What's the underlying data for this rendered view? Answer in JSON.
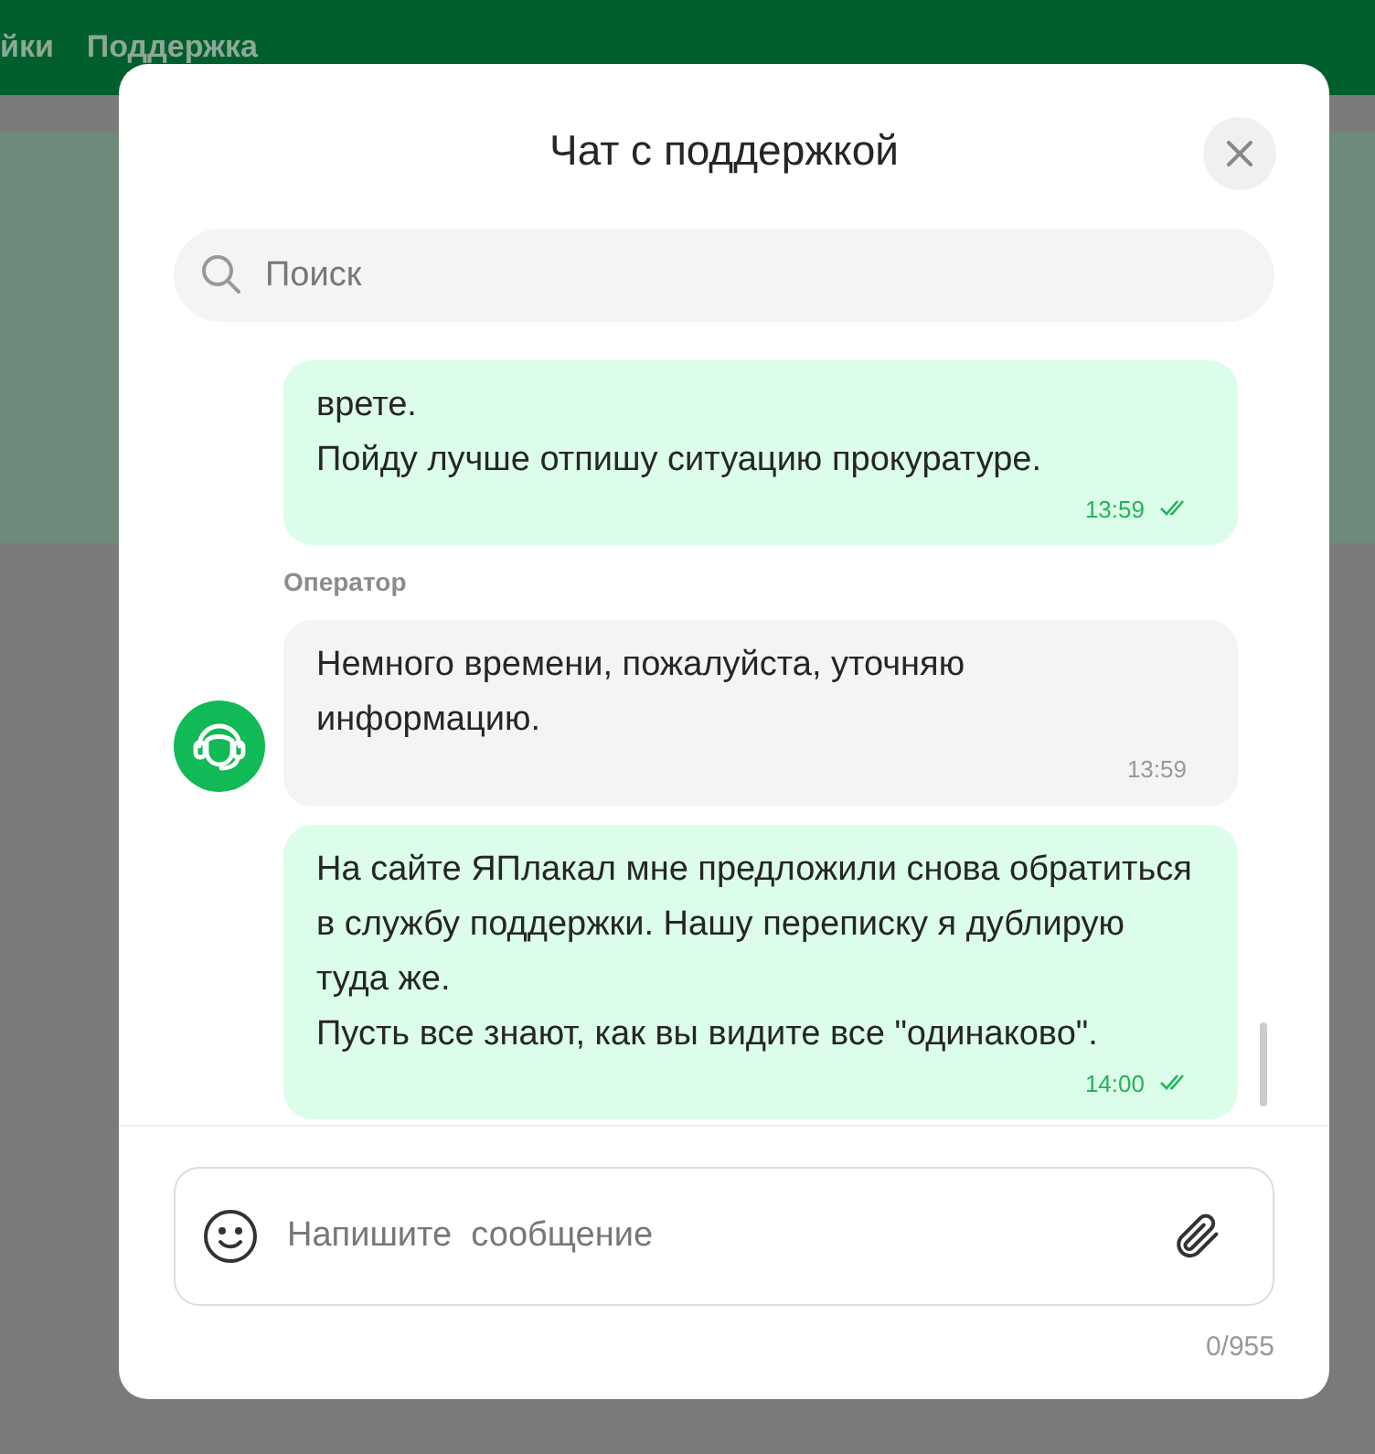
{
  "header": {
    "nav": [
      "йки",
      "Поддержка"
    ]
  },
  "chat": {
    "title": "Чат с поддержкой",
    "search": {
      "placeholder": "Поиск"
    },
    "messages": [
      {
        "kind": "user",
        "paragraphs": [
          "врете.",
          "Пойду лучше отпишу ситуацию прокуратуре."
        ],
        "time": "13:59",
        "read": true
      },
      {
        "kind": "operator",
        "sender": "Оператор",
        "paragraphs": [
          "Немного времени, пожалуйста, уточняю информацию."
        ],
        "time": "13:59"
      },
      {
        "kind": "user",
        "paragraphs": [
          "На сайте ЯПлакал мне предложили снова обратиться в службу поддержки. Нашу переписку я дублирую туда же.",
          "Пусть все знают, как вы видите все \"одинаково\"."
        ],
        "time": "14:00",
        "read": true
      }
    ],
    "composer": {
      "placeholder": "Напишите  сообщение",
      "counter": "0/955"
    }
  }
}
